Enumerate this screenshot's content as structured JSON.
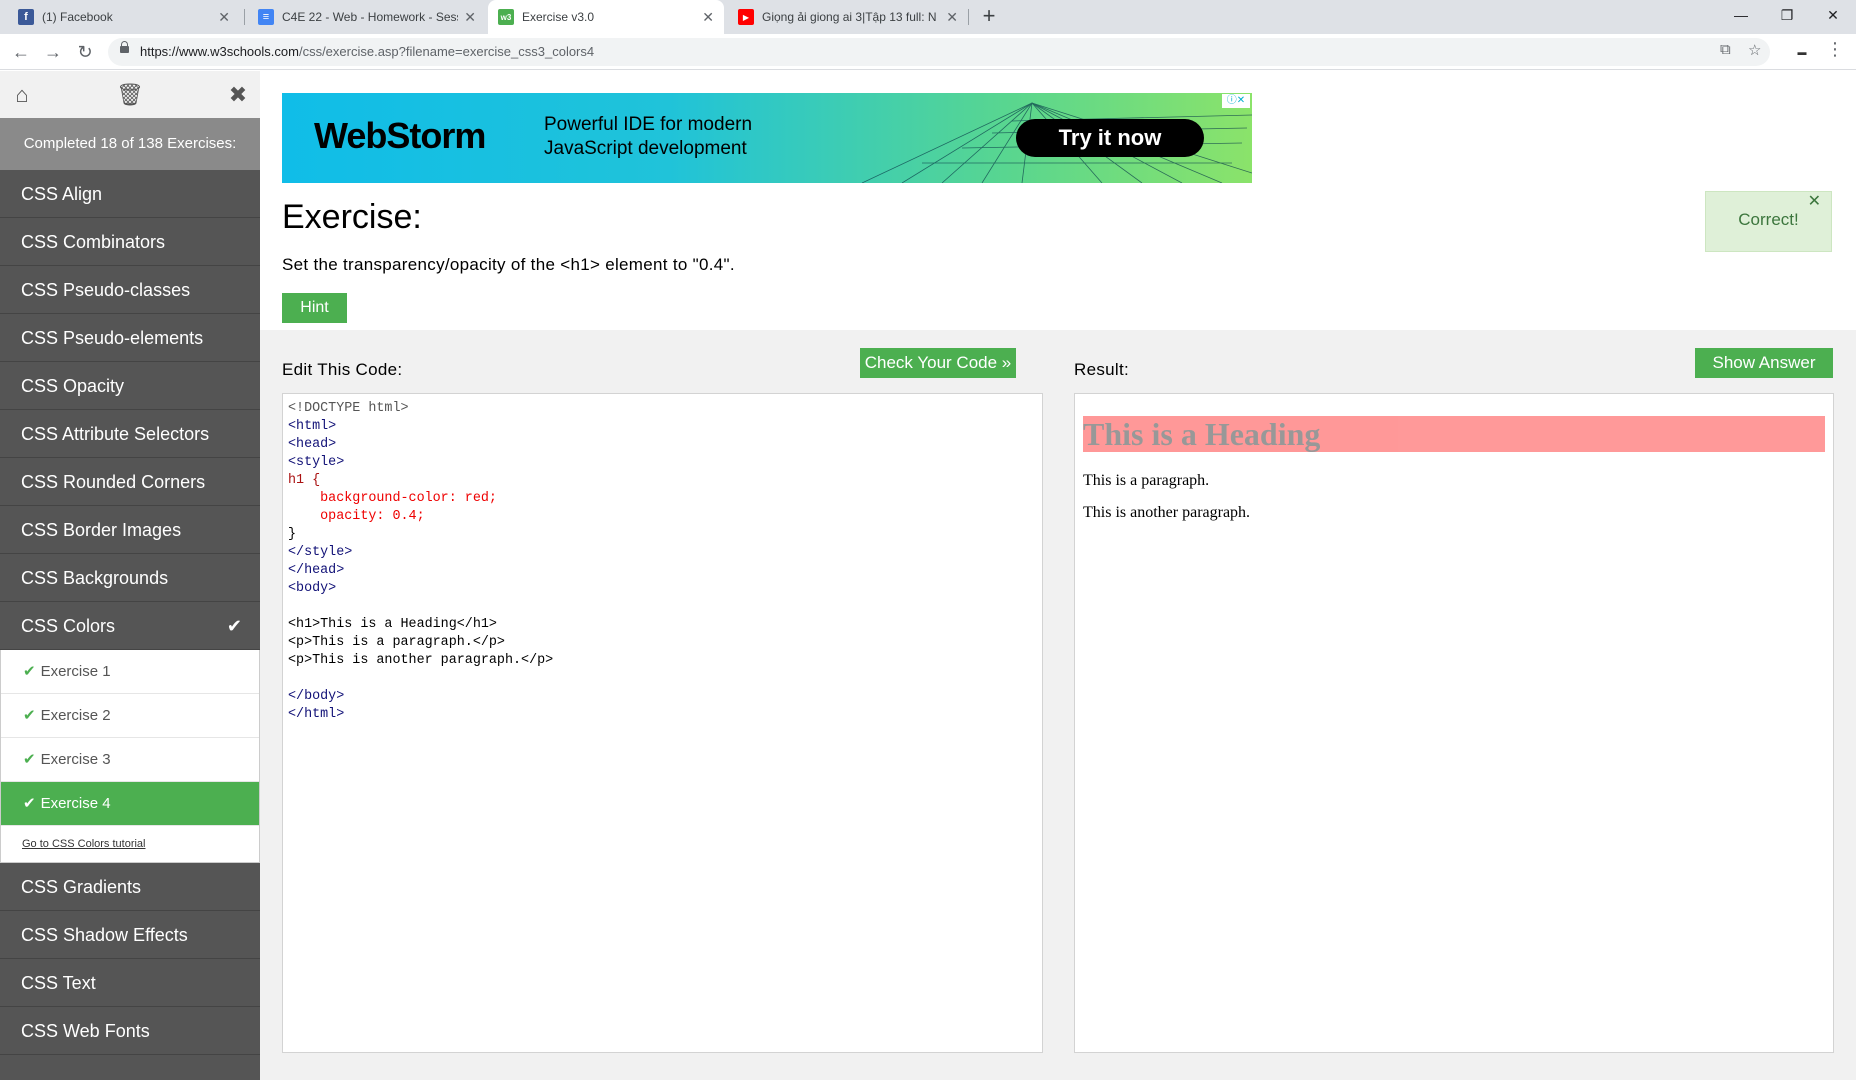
{
  "browser": {
    "tabs": [
      {
        "title": "(1) Facebook",
        "icon": "facebook-icon",
        "active": false
      },
      {
        "title": "C4E 22 - Web - Homework - Sess",
        "icon": "google-docs-icon",
        "active": false
      },
      {
        "title": "Exercise v3.0",
        "icon": "w3schools-icon",
        "active": true
      },
      {
        "title": "Giọng ải giong ai 3|Tập 13 full: N",
        "icon": "youtube-icon",
        "active": false
      }
    ],
    "url_host": "https://www.w3schools.com",
    "url_path": "/css/exercise.asp?filename=exercise_css3_colors4"
  },
  "sidebar": {
    "completed": "Completed 18 of 138 Exercises:",
    "items_before": [
      "CSS Align",
      "CSS Combinators",
      "CSS Pseudo-classes",
      "CSS Pseudo-elements",
      "CSS Opacity",
      "CSS Attribute Selectors",
      "CSS Rounded Corners",
      "CSS Border Images",
      "CSS Backgrounds"
    ],
    "open_item": "CSS Colors",
    "sub_items": [
      "Exercise 1",
      "Exercise 2",
      "Exercise 3",
      "Exercise 4"
    ],
    "active_sub_index": 3,
    "tutorial_link": "Go to CSS Colors tutorial",
    "items_after": [
      "CSS Gradients",
      "CSS Shadow Effects",
      "CSS Text",
      "CSS Web Fonts"
    ]
  },
  "ad": {
    "brand": "WebStorm",
    "tagline": "Powerful IDE for modern JavaScript development",
    "cta": "Try it now"
  },
  "exercise": {
    "title": "Exercise:",
    "description": "Set the transparency/opacity of the <h1> element to \"0.4\".",
    "hint": "Hint",
    "toast": "Correct!"
  },
  "editor": {
    "label": "Edit This Code:",
    "check_button": "Check Your Code »",
    "lines": [
      "<!DOCTYPE html>",
      "<html>",
      "<head>",
      "<style>",
      "h1 {",
      "    background-color: red;",
      "    opacity: 0.4;",
      "}",
      "</style>",
      "</head>",
      "<body>",
      "",
      "<h1>This is a Heading</h1>",
      "<p>This is a paragraph.</p>",
      "<p>This is another paragraph.</p>",
      "",
      "</body>",
      "</html>"
    ]
  },
  "result": {
    "label": "Result:",
    "answer_button": "Show Answer",
    "heading": "This is a Heading",
    "paragraph1": "This is a paragraph.",
    "paragraph2": "This is another paragraph."
  },
  "colors": {
    "accent": "#4caf50",
    "sidebar": "#555555",
    "toast_bg": "#dff0d8"
  }
}
